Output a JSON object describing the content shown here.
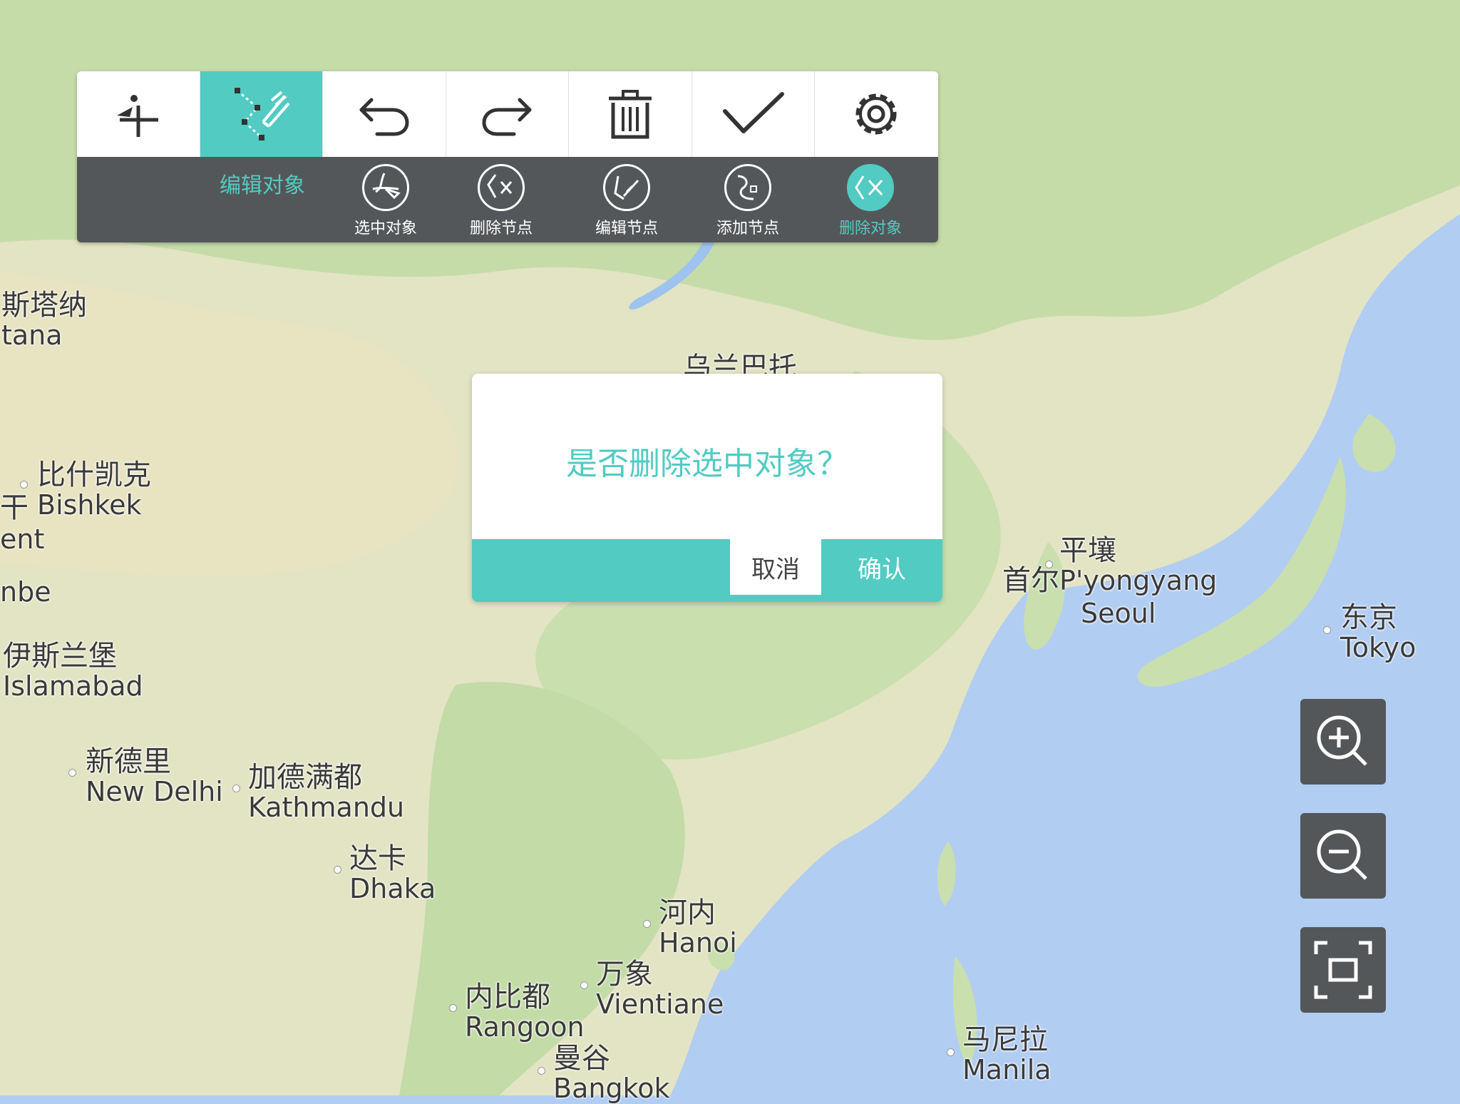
{
  "toolbar": {
    "tools": [
      {
        "name": "add-point-icon"
      },
      {
        "name": "edit-object-icon",
        "active": true
      },
      {
        "name": "undo-icon"
      },
      {
        "name": "redo-icon"
      },
      {
        "name": "trash-icon"
      },
      {
        "name": "check-icon"
      },
      {
        "name": "gear-icon"
      }
    ],
    "sub_title": "编辑对象",
    "sub_tools": [
      {
        "label": "选中对象",
        "icon": "select-object-icon"
      },
      {
        "label": "删除节点",
        "icon": "delete-node-icon"
      },
      {
        "label": "编辑节点",
        "icon": "edit-node-icon"
      },
      {
        "label": "添加节点",
        "icon": "add-node-icon"
      },
      {
        "label": "删除对象",
        "icon": "delete-object-icon",
        "active": true
      }
    ],
    "accent_color": "#52cbc2"
  },
  "dialog": {
    "message": "是否删除选中对象？",
    "cancel_label": "取消",
    "confirm_label": "确认"
  },
  "map": {
    "labels": [
      {
        "cn": "斯塔纳",
        "en": "tana"
      },
      {
        "cn": "比什凯克",
        "en": "Bishkek"
      },
      {
        "cn": "干",
        "en": ""
      },
      {
        "cn": "",
        "en": "ent"
      },
      {
        "cn": "",
        "en": "nbe"
      },
      {
        "cn": "伊斯兰堡",
        "en": "Islamabad"
      },
      {
        "cn": "新德里",
        "en": "New Delhi"
      },
      {
        "cn": "加德满都",
        "en": "Kathmandu"
      },
      {
        "cn": "达卡",
        "en": "Dhaka"
      },
      {
        "cn": "河内",
        "en": "Hanoi"
      },
      {
        "cn": "万象",
        "en": "Vientiane"
      },
      {
        "cn": "内比都",
        "en": "Rangoon"
      },
      {
        "cn": "曼谷",
        "en": "Bangkok"
      },
      {
        "cn": "平壤",
        "en": "P'yongyang"
      },
      {
        "cn": "首尔",
        "en": "Seoul"
      },
      {
        "cn": "东京",
        "en": "Tokyo"
      },
      {
        "cn": "马尼拉",
        "en": "Manila"
      },
      {
        "cn": "乌兰巴托",
        "en": ""
      }
    ]
  },
  "zoom": {
    "buttons": [
      {
        "name": "zoom-in-icon"
      },
      {
        "name": "zoom-out-icon"
      },
      {
        "name": "full-extent-icon"
      }
    ]
  }
}
